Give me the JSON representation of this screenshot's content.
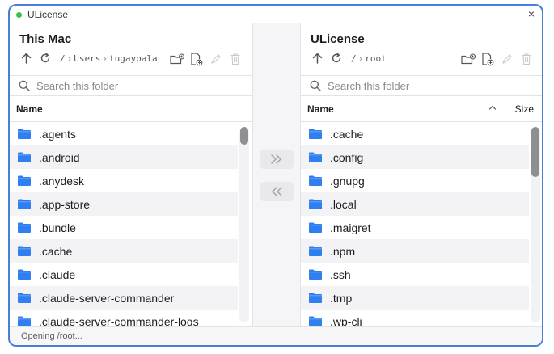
{
  "window": {
    "title": "ULicense",
    "status_color": "#33c24d",
    "close_label": "×"
  },
  "left_pane": {
    "title": "This Mac",
    "path": {
      "root": "/",
      "segment": "Users",
      "segment2": "tugaypala"
    },
    "search_placeholder": "Search this folder",
    "column_name": "Name",
    "items": [
      ".agents",
      ".android",
      ".anydesk",
      ".app-store",
      ".bundle",
      ".cache",
      ".claude",
      ".claude-server-commander",
      ".claude-server-commander-logs"
    ]
  },
  "right_pane": {
    "title": "ULicense",
    "path": {
      "root": "/",
      "segment": "root"
    },
    "search_placeholder": "Search this folder",
    "column_name": "Name",
    "column_size": "Size",
    "items": [
      ".cache",
      ".config",
      ".gnupg",
      ".local",
      ".maigret",
      ".npm",
      ".ssh",
      ".tmp",
      ".wp-cli"
    ]
  },
  "transfer": {
    "upload_icon": "double-chevron-right-icon",
    "download_icon": "double-chevron-left-icon"
  },
  "status": {
    "text": "Opening /root..."
  },
  "colors": {
    "accent": "#4a7fd9",
    "folder": "#2f7ff0"
  }
}
